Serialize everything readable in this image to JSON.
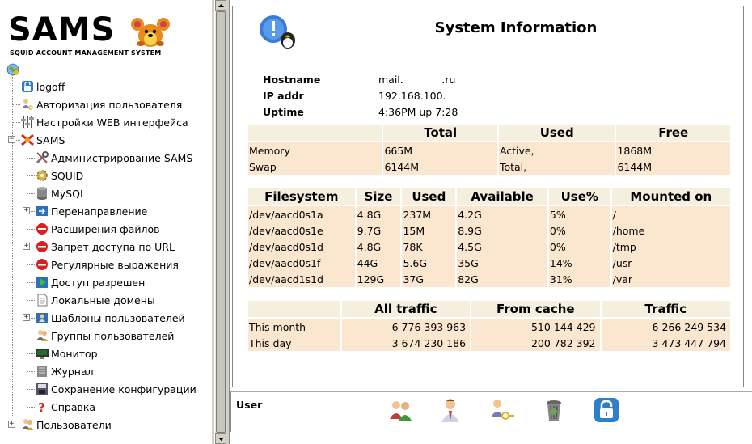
{
  "logo": {
    "title": "SAMS",
    "subtitle": "SQUID ACCOUNT MANAGEMENT SYSTEM"
  },
  "tree": {
    "items": [
      {
        "label": "logoff",
        "icon": "lock-icon"
      },
      {
        "label": "Авторизация пользователя",
        "icon": "user-key-icon"
      },
      {
        "label": "Настройки WEB интерфейса",
        "icon": "settings-sliders-icon"
      },
      {
        "label": "SAMS",
        "icon": "sams-icon"
      },
      {
        "label": "Администрирование SAMS",
        "icon": "tools-icon"
      },
      {
        "label": "SQUID",
        "icon": "gear-icon"
      },
      {
        "label": "MySQL",
        "icon": "database-icon"
      },
      {
        "label": "Перенаправление",
        "icon": "redirect-icon"
      },
      {
        "label": "Расширения файлов",
        "icon": "deny-icon"
      },
      {
        "label": "Запрет доступа по URL",
        "icon": "deny-icon"
      },
      {
        "label": "Регулярные выражения",
        "icon": "deny-icon"
      },
      {
        "label": "Доступ разрешен",
        "icon": "allow-icon"
      },
      {
        "label": "Локальные домены",
        "icon": "document-icon"
      },
      {
        "label": "Шаблоны пользователей",
        "icon": "templates-icon"
      },
      {
        "label": "Группы пользователей",
        "icon": "group-icon"
      },
      {
        "label": "Монитор",
        "icon": "monitor-icon"
      },
      {
        "label": "Журнал",
        "icon": "journal-icon"
      },
      {
        "label": "Сохранение конфигурации",
        "icon": "save-icon"
      },
      {
        "label": "Справка",
        "icon": "help-icon"
      },
      {
        "label": "Пользователи",
        "icon": "users-icon"
      }
    ]
  },
  "page": {
    "title": "System Information"
  },
  "host": {
    "rows": [
      {
        "k": "Hostname",
        "v": "mail.            .ru"
      },
      {
        "k": "IP addr",
        "v": "192.168.100."
      },
      {
        "k": "Uptime",
        "v": "4:36PM up 7:28"
      }
    ]
  },
  "memory": {
    "headers": [
      "",
      "Total",
      "Used",
      "Free"
    ],
    "rows": [
      [
        "Memory",
        "665M",
        "Active,",
        "1868M"
      ],
      [
        "Swap",
        "6144M",
        "Total,",
        "6144M"
      ]
    ]
  },
  "fs": {
    "headers": [
      "Filesystem",
      "Size",
      "Used",
      "Available",
      "Use%",
      "Mounted on"
    ],
    "rows": [
      [
        "/dev/aacd0s1a",
        "4.8G",
        "237M",
        "4.2G",
        "5%",
        "/"
      ],
      [
        "/dev/aacd0s1e",
        "9.7G",
        "15M",
        "8.9G",
        "0%",
        "/home"
      ],
      [
        "/dev/aacd0s1d",
        "4.8G",
        "78K",
        "4.5G",
        "0%",
        "/tmp"
      ],
      [
        "/dev/aacd0s1f",
        "44G",
        "5.6G",
        "35G",
        "14%",
        "/usr"
      ],
      [
        "/dev/aacd1s1d",
        "129G",
        "37G",
        "82G",
        "31%",
        "/var"
      ]
    ]
  },
  "traffic": {
    "headers": [
      "",
      "All traffic",
      "From cache",
      "Traffic"
    ],
    "rows": [
      [
        "This month",
        "6 776 393 963",
        "510 144 429",
        "6 266 249 534"
      ],
      [
        "This day",
        "3 674 230 186",
        "200 782 392",
        "3 473 447 794"
      ]
    ]
  },
  "user_bar": {
    "label": "User",
    "icons": [
      "users-pair-icon",
      "user-profile-icon",
      "user-key-icon",
      "trash-icon",
      "lock-icon"
    ]
  }
}
